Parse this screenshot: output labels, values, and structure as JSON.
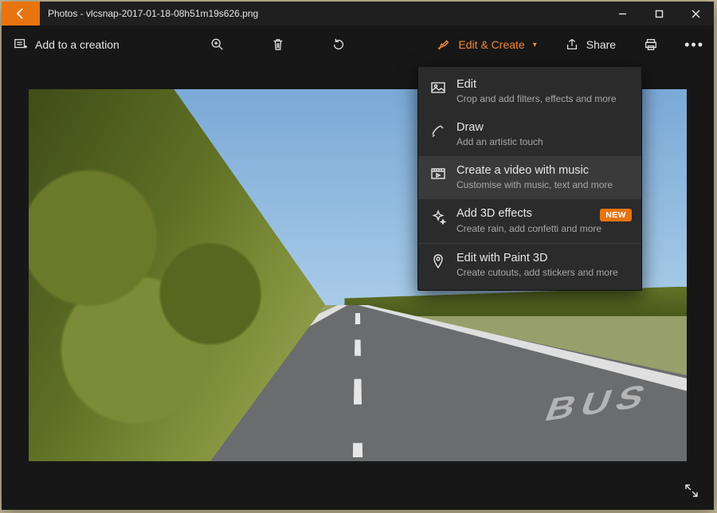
{
  "window": {
    "app_name": "Photos",
    "file_name": "vlcsnap-2017-01-18-08h51m19s626.png",
    "title": "Photos - vlcsnap-2017-01-18-08h51m19s626.png"
  },
  "toolbar": {
    "add_to_creation": "Add to a creation",
    "edit_create": "Edit & Create",
    "share": "Share"
  },
  "menu": {
    "items": [
      {
        "id": "edit",
        "title": "Edit",
        "subtitle": "Crop and add filters, effects and more",
        "highlight": false,
        "badge": null
      },
      {
        "id": "draw",
        "title": "Draw",
        "subtitle": "Add an artistic touch",
        "highlight": false,
        "badge": null
      },
      {
        "id": "video",
        "title": "Create a video with music",
        "subtitle": "Customise with music, text and more",
        "highlight": true,
        "badge": null
      },
      {
        "id": "3d",
        "title": "Add 3D effects",
        "subtitle": "Create rain, add confetti and more",
        "highlight": false,
        "badge": "NEW",
        "sep_after": true
      },
      {
        "id": "paint3d",
        "title": "Edit with Paint 3D",
        "subtitle": "Create cutouts, add stickers and more",
        "highlight": false,
        "badge": null
      }
    ]
  },
  "colors": {
    "accent": "#e8740f",
    "toolbar_accent": "#f0883e"
  }
}
